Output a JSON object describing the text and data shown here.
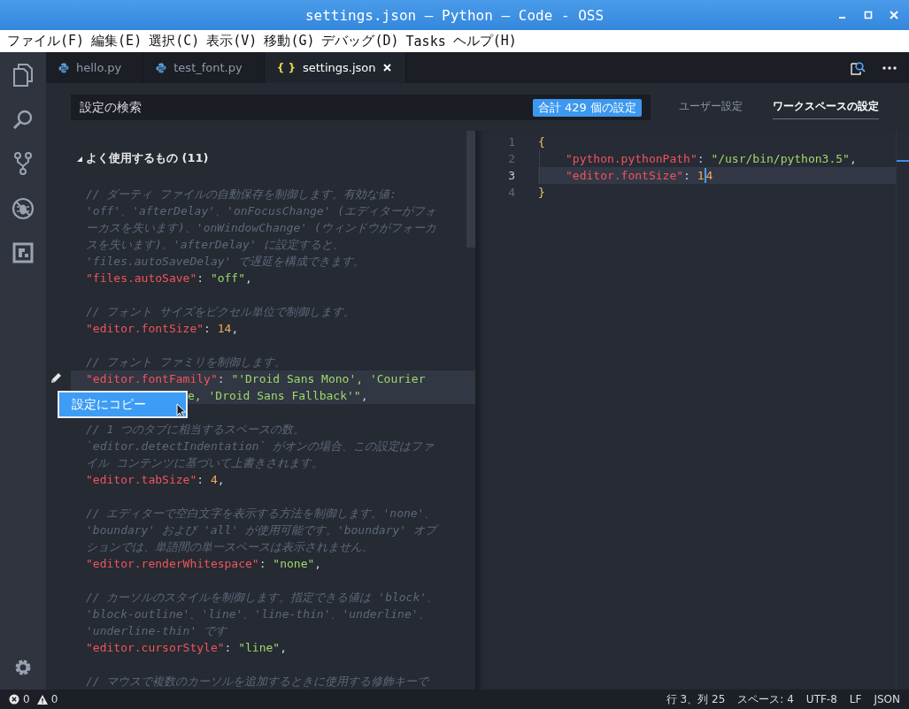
{
  "window": {
    "title": "settings.json — Python — Code - OSS"
  },
  "menu": [
    "ファイル(F)",
    "編集(E)",
    "選択(C)",
    "表示(V)",
    "移動(G)",
    "デバッグ(D)",
    "Tasks",
    "ヘルプ(H)"
  ],
  "tabs": [
    {
      "label": "hello.py",
      "kind": "python",
      "selected": false
    },
    {
      "label": "test_font.py",
      "kind": "python",
      "selected": false
    },
    {
      "label": "settings.json",
      "kind": "json",
      "icon": "{ }",
      "selected": true
    }
  ],
  "settings_search": {
    "placeholder": "設定の検索",
    "count_badge": "合計 429 個の設定"
  },
  "scope_tabs": [
    {
      "label": "ユーザー設定",
      "selected": false
    },
    {
      "label": "ワークスペースの設定",
      "selected": true
    }
  ],
  "default_settings": {
    "group": {
      "label": "よく使用するもの (11)",
      "expanded": true
    },
    "sections": [
      {
        "hovered": false,
        "lines": [
          [
            {
              "text": "// ダーティ ファイルの自動保存を制御します。有効な値:",
              "kind": "comment"
            }
          ],
          [
            {
              "text": "'off'、'afterDelay'、'onFocusChange' (エディターがフォ",
              "kind": "comment"
            }
          ],
          [
            {
              "text": "ーカスを失います)、'onWindowChange' (ウィンドウがフォーカ",
              "kind": "comment"
            }
          ],
          [
            {
              "text": "スを失います)。'afterDelay' に設定すると、",
              "kind": "comment"
            }
          ],
          [
            {
              "text": "'files.autoSaveDelay' で遅延を構成できます。",
              "kind": "comment"
            }
          ],
          [
            {
              "text": "\"files.autoSave\"",
              "kind": "key"
            },
            {
              "text": ": ",
              "kind": "punct"
            },
            {
              "text": "\"off\"",
              "kind": "string"
            },
            {
              "text": ",",
              "kind": "punct"
            }
          ]
        ]
      },
      {
        "hovered": false,
        "lines": [
          [
            {
              "text": "// フォント サイズをピクセル単位で制御します。",
              "kind": "comment"
            }
          ],
          [
            {
              "text": "\"editor.fontSize\"",
              "kind": "key"
            },
            {
              "text": ": ",
              "kind": "punct"
            },
            {
              "text": "14",
              "kind": "number"
            },
            {
              "text": ",",
              "kind": "punct"
            }
          ]
        ]
      },
      {
        "hovered": true,
        "lines": [
          [
            {
              "text": "// フォント ファミリを制御します。",
              "kind": "comment"
            }
          ],
          [
            {
              "text": "\"editor.fontFamily\"",
              "kind": "key"
            },
            {
              "text": ": ",
              "kind": "punct"
            },
            {
              "text": "\"'Droid Sans Mono', 'Courier",
              "kind": "string"
            }
          ],
          [
            {
              "text": "設定にコピー",
              "kind": "menu"
            },
            {
              "text": "e, 'Droid Sans Fallback'\"",
              "kind": "string"
            },
            {
              "text": ",",
              "kind": "punct"
            }
          ]
        ]
      },
      {
        "hovered": false,
        "lines": [
          [
            {
              "text": "// 1 つのタブに相当するスペースの数。",
              "kind": "comment"
            }
          ],
          [
            {
              "text": "`editor.detectIndentation` がオンの場合、この設定はファ",
              "kind": "comment"
            }
          ],
          [
            {
              "text": "イル コンテンツに基づいて上書きされます。",
              "kind": "comment"
            }
          ],
          [
            {
              "text": "\"editor.tabSize\"",
              "kind": "key"
            },
            {
              "text": ": ",
              "kind": "punct"
            },
            {
              "text": "4",
              "kind": "number"
            },
            {
              "text": ",",
              "kind": "punct"
            }
          ]
        ]
      },
      {
        "hovered": false,
        "lines": [
          [
            {
              "text": "// エディターで空白文字を表示する方法を制御します。'none'、",
              "kind": "comment"
            }
          ],
          [
            {
              "text": "'boundary' および 'all' が使用可能です。'boundary' オプ",
              "kind": "comment"
            }
          ],
          [
            {
              "text": "ションでは、単語間の単一スペースは表示されません。",
              "kind": "comment"
            }
          ],
          [
            {
              "text": "\"editor.renderWhitespace\"",
              "kind": "key"
            },
            {
              "text": ": ",
              "kind": "punct"
            },
            {
              "text": "\"none\"",
              "kind": "string"
            },
            {
              "text": ",",
              "kind": "punct"
            }
          ]
        ]
      },
      {
        "hovered": false,
        "lines": [
          [
            {
              "text": "// カーソルのスタイルを制御します。指定できる値は 'block'、",
              "kind": "comment"
            }
          ],
          [
            {
              "text": "'block-outline'、'line'、'line-thin'、'underline'、",
              "kind": "comment"
            }
          ],
          [
            {
              "text": "'underline-thin' です",
              "kind": "comment"
            }
          ],
          [
            {
              "text": "\"editor.cursorStyle\"",
              "kind": "key"
            },
            {
              "text": ": ",
              "kind": "punct"
            },
            {
              "text": "\"line\"",
              "kind": "string"
            },
            {
              "text": ",",
              "kind": "punct"
            }
          ]
        ]
      },
      {
        "hovered": false,
        "lines": [
          [
            {
              "text": "// マウスで複数のカーソルを追加するときに使用する修飾キーで",
              "kind": "comment"
            }
          ]
        ]
      }
    ]
  },
  "editor": {
    "lines": [
      {
        "number": "1",
        "indented": false,
        "current": false,
        "tokens": [
          {
            "text": "{",
            "kind": "brace"
          }
        ]
      },
      {
        "number": "2",
        "indented": true,
        "current": false,
        "tokens": [
          {
            "text": "\"python.pythonPath\"",
            "kind": "key"
          },
          {
            "text": ": ",
            "kind": "punct"
          },
          {
            "text": "\"/usr/bin/python3.5\"",
            "kind": "string"
          },
          {
            "text": ",",
            "kind": "punct"
          }
        ]
      },
      {
        "number": "3",
        "indented": true,
        "current": true,
        "tokens": [
          {
            "text": "\"editor.fontSize\"",
            "kind": "key"
          },
          {
            "text": ": ",
            "kind": "punct"
          },
          {
            "text": "1",
            "kind": "number"
          },
          {
            "kind": "cursor"
          },
          {
            "text": "4",
            "kind": "number"
          }
        ]
      },
      {
        "number": "4",
        "indented": false,
        "current": false,
        "tokens": [
          {
            "text": "}",
            "kind": "brace"
          }
        ]
      }
    ]
  },
  "status_bar": {
    "errors": "0",
    "warnings": "0",
    "items": [
      "行 3、列 25",
      "スペース: 4",
      "UTF-8",
      "LF",
      "JSON"
    ]
  }
}
